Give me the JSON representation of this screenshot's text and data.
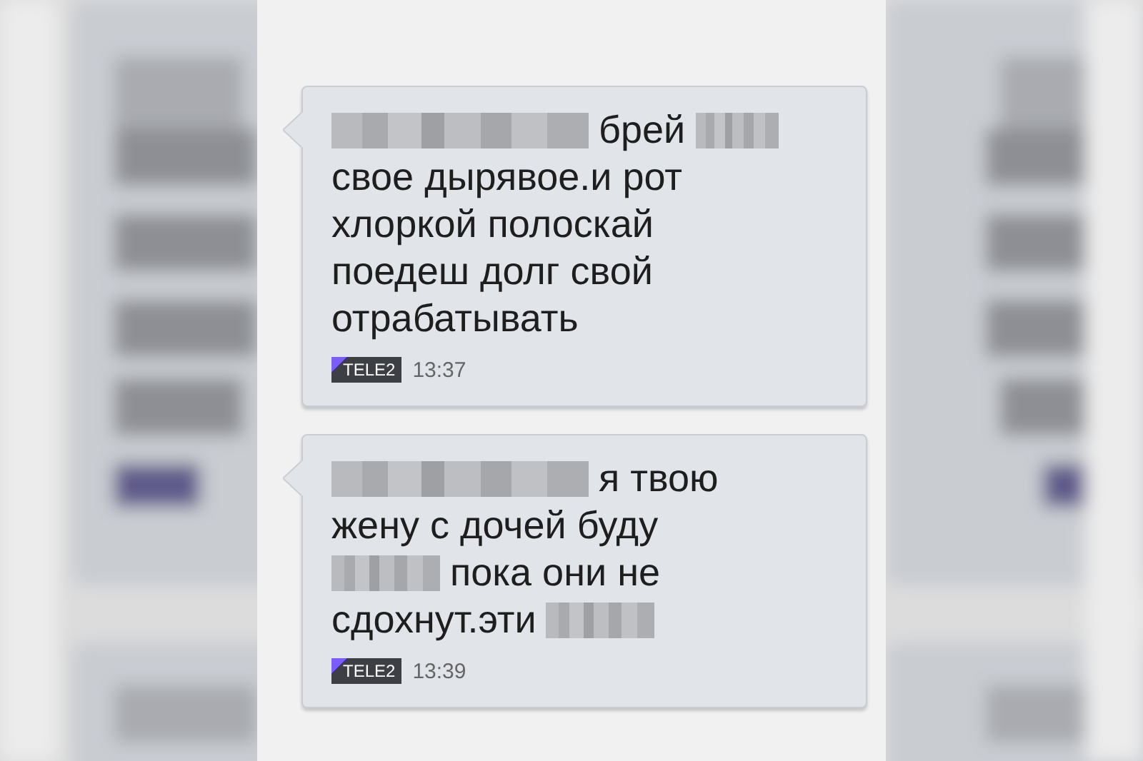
{
  "messages": [
    {
      "lines": [
        [
          {
            "kind": "blurlong"
          },
          {
            "kind": "text",
            "text": "брей"
          },
          {
            "kind": "blurshort"
          }
        ],
        [
          {
            "kind": "text",
            "text": "свое дырявое.и рот"
          }
        ],
        [
          {
            "kind": "text",
            "text": "хлоркой полоскай"
          }
        ],
        [
          {
            "kind": "text",
            "text": "поедеш долг свой"
          }
        ],
        [
          {
            "kind": "text",
            "text": "отрабатывать"
          }
        ]
      ],
      "carrier": "TELE2",
      "time": "13:37"
    },
    {
      "lines": [
        [
          {
            "kind": "blurlong"
          },
          {
            "kind": "text",
            "text": "я твою"
          }
        ],
        [
          {
            "kind": "text",
            "text": "жену с дочей буду"
          }
        ],
        [
          {
            "kind": "blur"
          },
          {
            "kind": "text",
            "text": "пока они не"
          }
        ],
        [
          {
            "kind": "text",
            "text": "сдохнут.эти"
          },
          {
            "kind": "blur"
          }
        ]
      ],
      "carrier": "TELE2",
      "time": "13:39"
    }
  ]
}
